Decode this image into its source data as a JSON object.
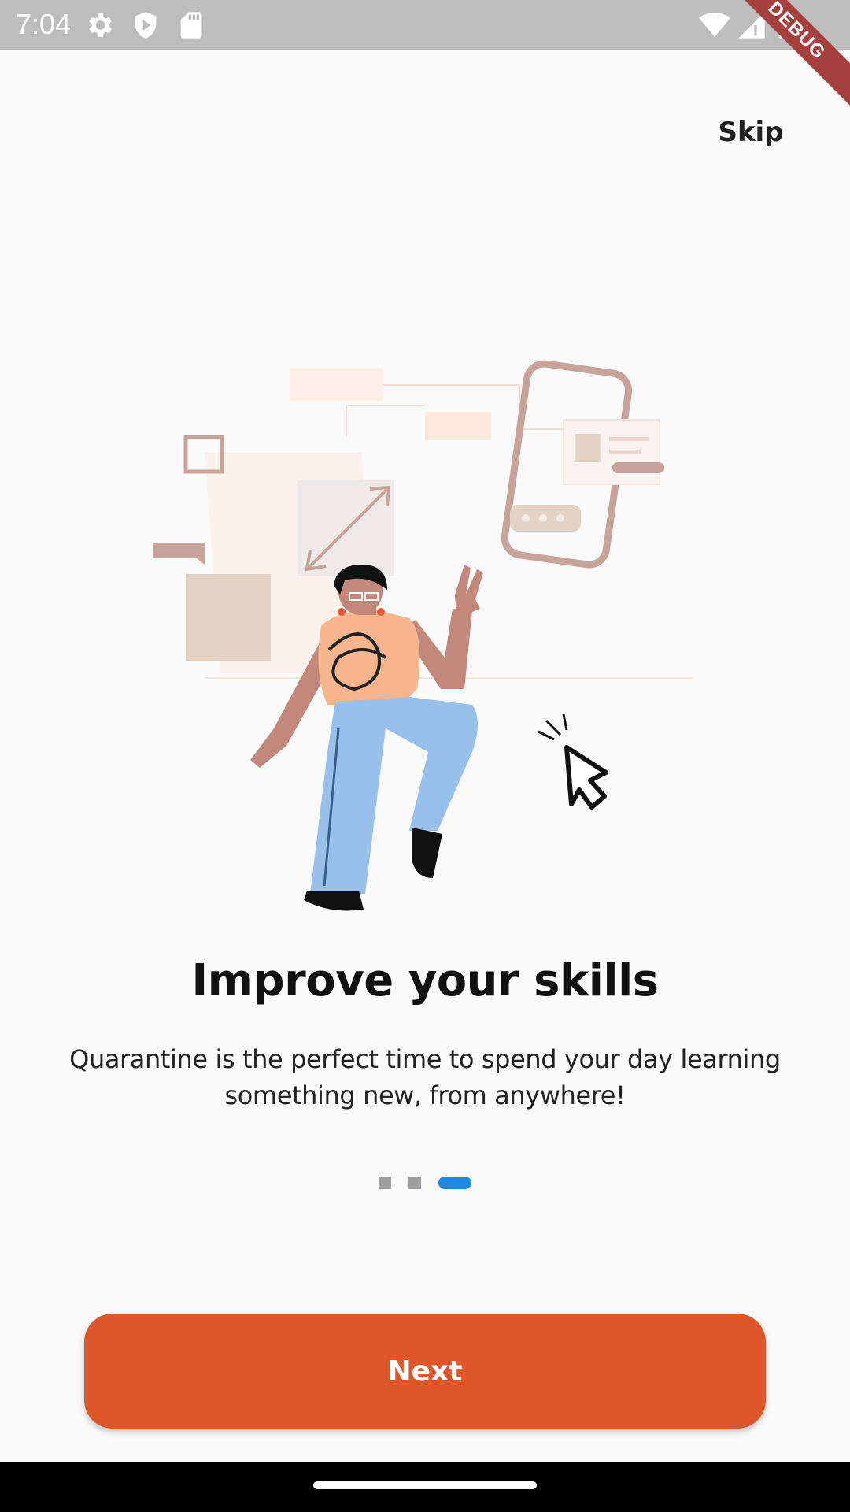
{
  "status_bar": {
    "time": "7:04",
    "icons": [
      "settings-icon",
      "shield-icon",
      "sd-card-icon",
      "wifi-icon",
      "signal-icon",
      "battery-icon"
    ],
    "background": "#bdbdbd"
  },
  "debug_banner": "DEBUG",
  "onboarding": {
    "skip_label": "Skip",
    "title": "Improve your skills",
    "subtitle": "Quarantine is the perfect time to spend your day learning something new, from anywhere!",
    "page_count": 3,
    "active_page": 3,
    "next_label": "Next"
  },
  "colors": {
    "accent": "#e0562b",
    "indicator_active": "#1e88e5",
    "indicator_inactive": "#9e9e9e",
    "background": "#fafafa"
  }
}
